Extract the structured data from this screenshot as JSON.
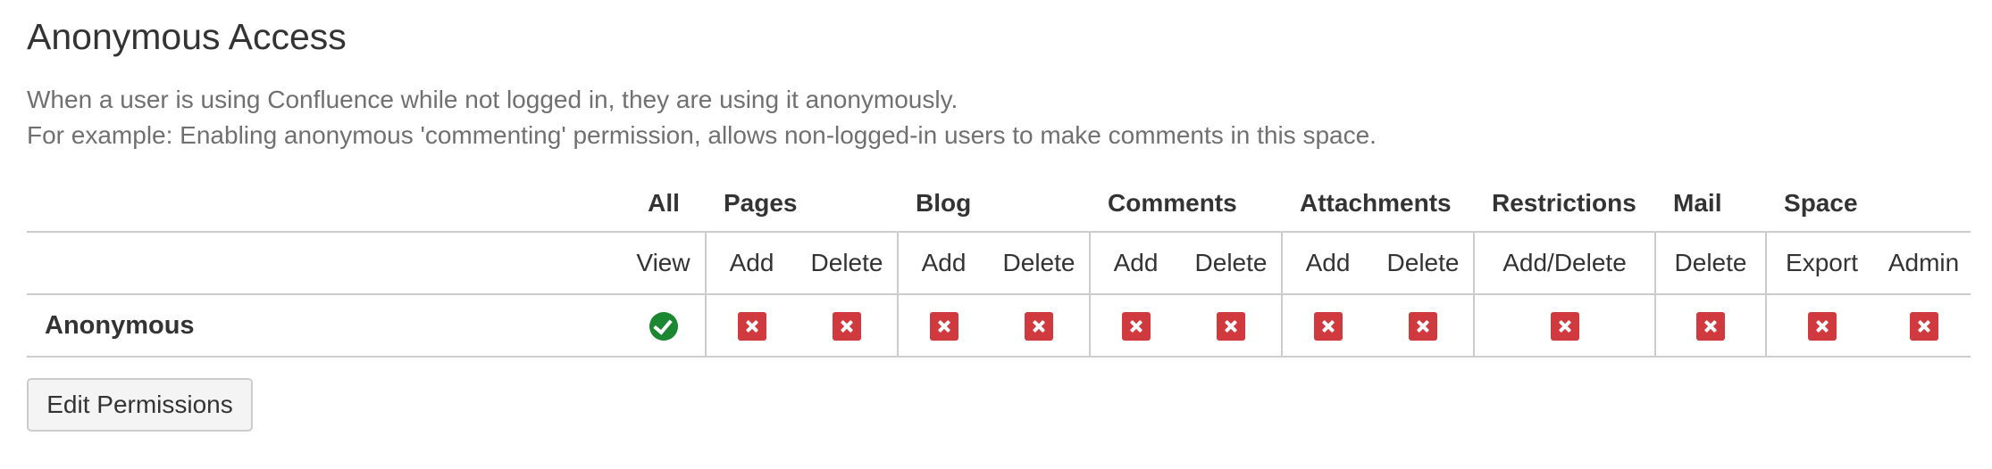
{
  "section": {
    "title": "Anonymous Access",
    "description": [
      "When a user is using Confluence while not logged in, they are using it anonymously.",
      "For example: Enabling anonymous 'commenting' permission, allows non-logged-in users to make comments in this space."
    ]
  },
  "table": {
    "groups": [
      "All",
      "Pages",
      "Blog",
      "Comments",
      "Attachments",
      "Restrictions",
      "Mail",
      "Space"
    ],
    "columns": [
      "View",
      "Add",
      "Delete",
      "Add",
      "Delete",
      "Add",
      "Delete",
      "Add",
      "Delete",
      "Add/Delete",
      "Delete",
      "Export",
      "Admin"
    ],
    "rows": [
      {
        "label": "Anonymous",
        "permissions": [
          "granted",
          "denied",
          "denied",
          "denied",
          "denied",
          "denied",
          "denied",
          "denied",
          "denied",
          "denied",
          "denied",
          "denied",
          "denied"
        ]
      }
    ]
  },
  "actions": {
    "edit_label": "Edit Permissions"
  },
  "colors": {
    "granted": "#1c8731",
    "denied": "#d0393d",
    "border": "#cccccc",
    "muted_text": "#707070"
  },
  "icons": {
    "granted": "check-circle-icon",
    "denied": "cross-square-icon"
  }
}
